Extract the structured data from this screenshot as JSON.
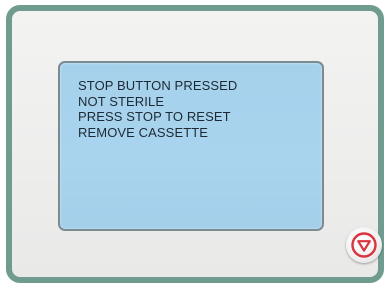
{
  "screen": {
    "messages": [
      "STOP BUTTON PRESSED",
      "NOT STERILE",
      "PRESS STOP TO RESET",
      "REMOVE CASSETTE"
    ]
  },
  "controls": {
    "stop_button_icon": "stop-triangle-icon"
  },
  "colors": {
    "frame": "#6f9c8f",
    "screen": "#a6d1ec",
    "stop_red": "#d9343f"
  }
}
